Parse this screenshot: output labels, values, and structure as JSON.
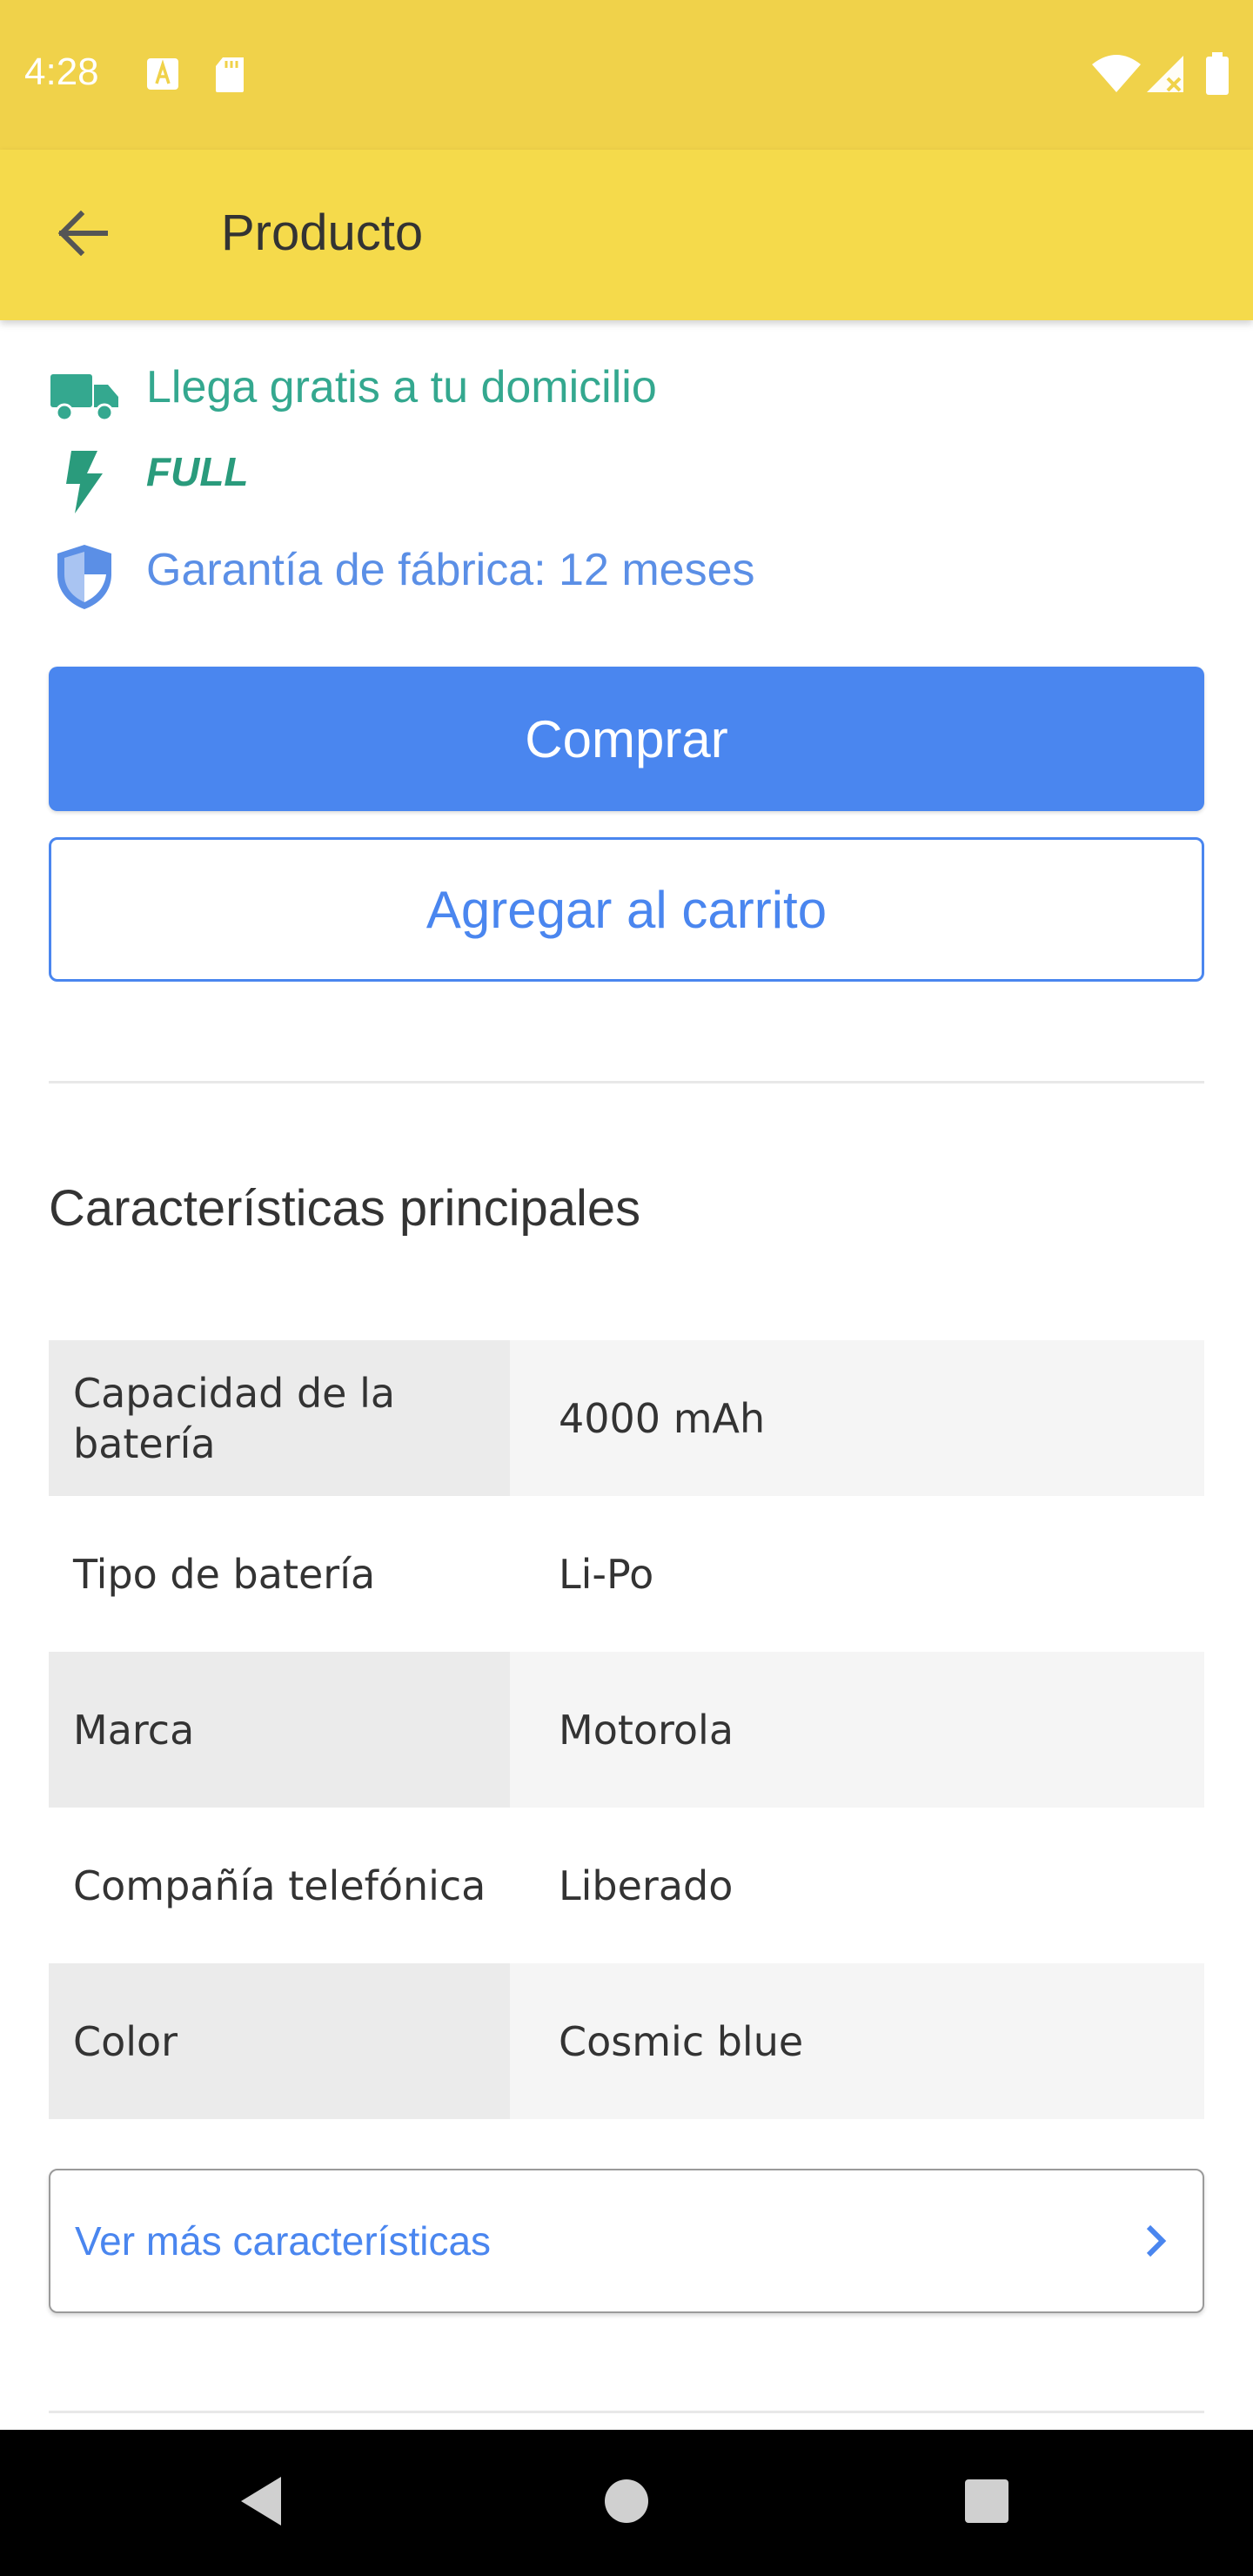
{
  "status_bar": {
    "time": "4:28",
    "notification_icons": [
      "a-box-icon",
      "sd-card-icon"
    ],
    "system_icons": [
      "wifi-icon",
      "signal-icon",
      "battery-icon"
    ]
  },
  "app_bar": {
    "title": "Producto",
    "back_icon": "arrow-left-icon"
  },
  "benefits": {
    "shipping": {
      "icon": "truck-icon",
      "text": "Llega gratis a tu domicilio"
    },
    "full": {
      "icon": "lightning-icon",
      "text": "FULL"
    },
    "warranty": {
      "icon": "shield-icon",
      "text": "Garantía de fábrica: 12 meses"
    }
  },
  "actions": {
    "buy_label": "Comprar",
    "add_to_cart_label": "Agregar al carrito"
  },
  "features": {
    "title": "Características principales",
    "rows": [
      {
        "key": "Capacidad de la batería",
        "value": "4000 mAh"
      },
      {
        "key": "Tipo de batería",
        "value": "Li-Po"
      },
      {
        "key": "Marca",
        "value": "Motorola"
      },
      {
        "key": "Compañía telefónica",
        "value": "Liberado"
      },
      {
        "key": "Color",
        "value": "Cosmic blue"
      }
    ],
    "more_label": "Ver más características"
  },
  "colors": {
    "status_bar": "#f0d24a",
    "app_bar": "#f5da4b",
    "accent_blue": "#4a86ef",
    "green": "#34a88f"
  },
  "nav_bar": {
    "buttons": [
      "back-triangle-icon",
      "home-circle-icon",
      "recents-square-icon"
    ]
  }
}
